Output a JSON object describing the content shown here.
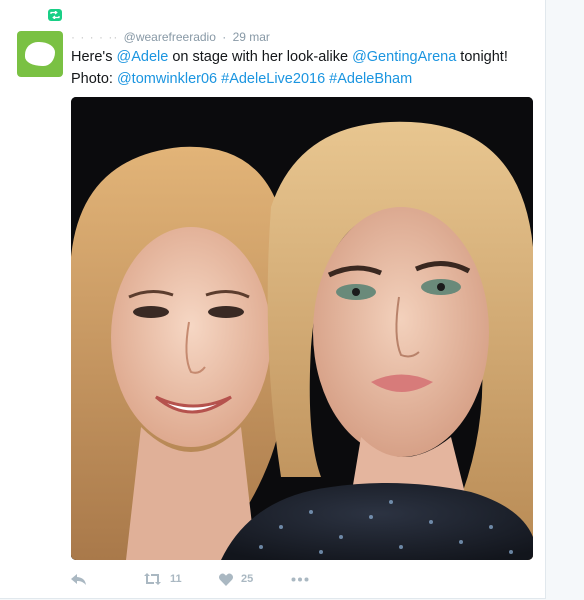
{
  "retweet_badge": {
    "icon": "retweet-icon",
    "color": "#19cf86"
  },
  "tweet": {
    "author_name": "· ·  ·  ·  ··",
    "handle": "@wearefreeradio",
    "separator": "·",
    "date": "29 mar",
    "text_parts": [
      "Here's ",
      "@Adele",
      " on stage with her look-alike ",
      "@GentingArena",
      " tonight!",
      "Photo: ",
      "@tomwinkler06",
      " ",
      "#AdeleLive2016",
      " ",
      "#AdeleBham"
    ],
    "avatar": {
      "icon": "avatar-image",
      "color": "#7ac143"
    },
    "media": {
      "icon": "selfie-photo"
    }
  },
  "actions": {
    "reply": {
      "icon": "reply-icon"
    },
    "retweet": {
      "icon": "retweet-icon",
      "count": "11"
    },
    "like": {
      "icon": "heart-icon",
      "count": "25"
    },
    "more": {
      "icon": "more-dots-icon"
    }
  },
  "colors": {
    "link": "#1b95e0",
    "muted": "#aab8c2",
    "accent_green": "#19cf86"
  }
}
